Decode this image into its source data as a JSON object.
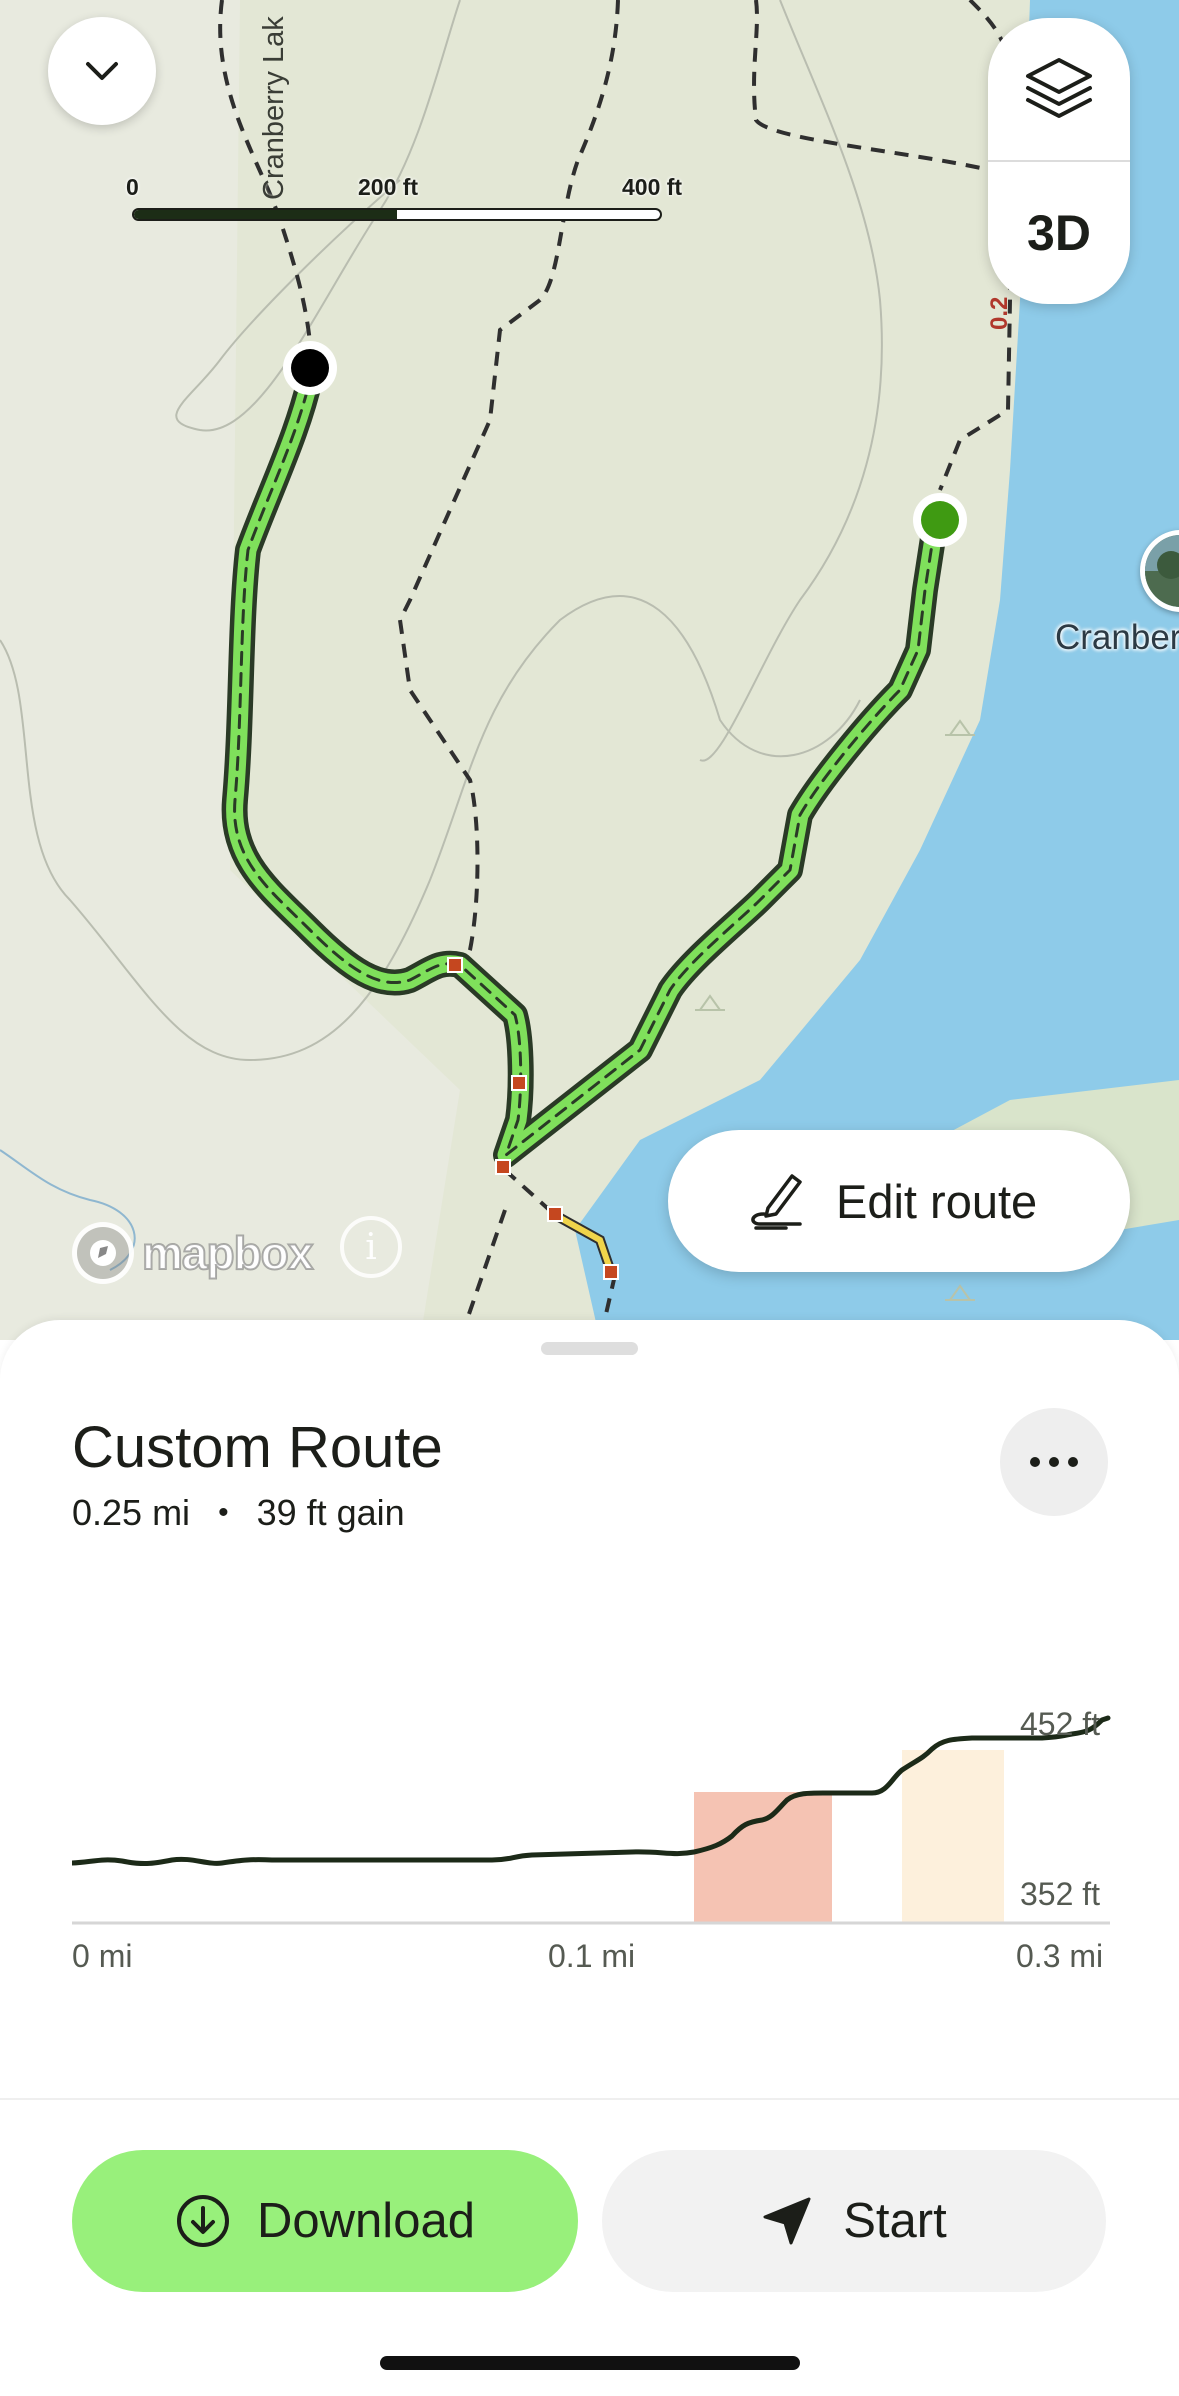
{
  "map": {
    "scale": {
      "zero": "0",
      "mid": "200 ft",
      "max": "400 ft",
      "fill_fraction": 0.5
    },
    "lake_label": "Cranberry Lak",
    "trail_distance_label": "0.2",
    "poi_label": "Cranber",
    "three_d_label": "3D",
    "edit_route_label": "Edit route",
    "attribution": "mapbox",
    "info_glyph": "i",
    "icons": {
      "collapse": "chevron-down-icon",
      "layers": "layers-icon",
      "edit": "pen-icon",
      "mapbox": "mapbox-logo-icon",
      "info": "info-icon"
    },
    "colors": {
      "water": "#8ecbe9",
      "land": "#e3e7d5",
      "route": "#7fe05b",
      "trail": "#2f2f2f"
    }
  },
  "route": {
    "title": "Custom Route",
    "distance": "0.25 mi",
    "separator": "•",
    "gain": "39 ft gain",
    "more_icon": "more-horizontal-icon"
  },
  "elevation": {
    "y_max_label": "452 ft",
    "y_min_label": "352 ft",
    "x_labels": [
      "0 mi",
      "0.1 mi",
      "0.3 mi"
    ],
    "grade_colors": {
      "steep": "#f5c3b3",
      "moderate": "#fdf0dc"
    }
  },
  "actions": {
    "download_label": "Download",
    "download_icon": "download-icon",
    "start_label": "Start",
    "start_icon": "navigation-arrow-icon"
  }
}
